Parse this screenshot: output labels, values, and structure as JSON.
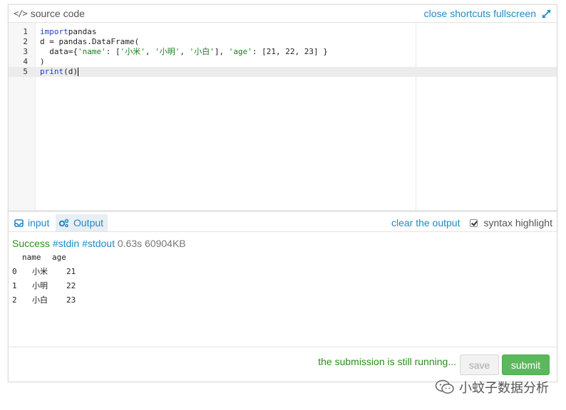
{
  "header": {
    "title": "source code",
    "links": [
      "close",
      "shortcuts",
      "fullscreen"
    ]
  },
  "editor": {
    "lines": [
      {
        "n": "1",
        "parts": [
          [
            "kw",
            "import"
          ],
          [
            "",
            "pandas"
          ]
        ]
      },
      {
        "n": "2",
        "parts": [
          [
            "",
            "d = pandas.DataFrame("
          ]
        ]
      },
      {
        "n": "3",
        "parts": [
          [
            "",
            "  data={"
          ],
          [
            "str",
            "'name'"
          ],
          [
            "",
            ": ["
          ],
          [
            "str",
            "'小米'"
          ],
          [
            "",
            ", "
          ],
          [
            "str",
            "'小明'"
          ],
          [
            "",
            ", "
          ],
          [
            "str",
            "'小白'"
          ],
          [
            "",
            "], "
          ],
          [
            "str",
            "'age'"
          ],
          [
            "",
            ": [21, 22, 23] }"
          ]
        ]
      },
      {
        "n": "4",
        "parts": [
          [
            "",
            ")"
          ]
        ]
      },
      {
        "n": "5",
        "parts": [
          [
            "kw",
            "print"
          ],
          [
            "",
            "(d)"
          ]
        ]
      }
    ]
  },
  "tabs": {
    "input": "input",
    "output": "Output",
    "clear": "clear the output",
    "syntax": "syntax highlight"
  },
  "result": {
    "status": "Success",
    "stdin": "#stdin",
    "stdout": "#stdout",
    "meta": "0.63s 60904KB"
  },
  "output_table": {
    "columns": [
      "name",
      "age"
    ],
    "rows": [
      {
        "idx": "0",
        "name": "小米",
        "age": "21"
      },
      {
        "idx": "1",
        "name": "小明",
        "age": "22"
      },
      {
        "idx": "2",
        "name": "小白",
        "age": "23"
      }
    ]
  },
  "footer": {
    "running": "the submission is still running...",
    "save": "save",
    "submit": "submit"
  },
  "watermark": "小蚊子数据分析",
  "colors": {
    "accent": "#1e8bc3",
    "success": "#2e8b1e",
    "submit": "#5cb85c"
  }
}
